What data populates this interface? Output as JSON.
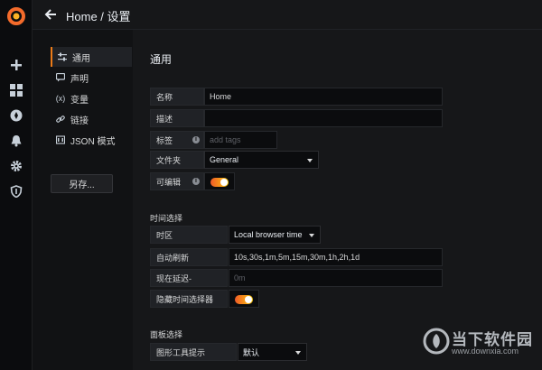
{
  "breadcrumb": "Home / 设置",
  "settings_nav": {
    "items": [
      {
        "label": "通用",
        "icon": "sliders-icon"
      },
      {
        "label": "声明",
        "icon": "comment-icon"
      },
      {
        "label": "变量",
        "icon": "variable-icon"
      },
      {
        "label": "链接",
        "icon": "link-icon"
      },
      {
        "label": "JSON 模式",
        "icon": "json-icon"
      }
    ],
    "save_as": "另存..."
  },
  "general": {
    "title": "通用",
    "name_label": "名称",
    "name_value": "Home",
    "desc_label": "描述",
    "desc_value": "",
    "tags_label": "标签",
    "tags_placeholder": "add tags",
    "folder_label": "文件夹",
    "folder_value": "General",
    "editable_label": "可编辑",
    "editable_on": true
  },
  "time": {
    "title": "时间选择",
    "tz_label": "时区",
    "tz_value": "Local browser time",
    "refresh_label": "自动刷新",
    "refresh_value": "10s,30s,1m,5m,15m,30m,1h,2h,1d",
    "delay_label": "现在延迟-",
    "delay_placeholder": "0m",
    "hide_label": "隐藏时间选择器",
    "hide_on": true
  },
  "panel": {
    "title": "面板选择",
    "tooltip_label": "图形工具提示",
    "tooltip_value": "默认"
  },
  "watermark": {
    "text": "当下软件园",
    "url": "www.downxia.com"
  },
  "colors": {
    "accent": "#eb7b18",
    "background": "#161719",
    "sidebar": "#0b0c0e"
  }
}
